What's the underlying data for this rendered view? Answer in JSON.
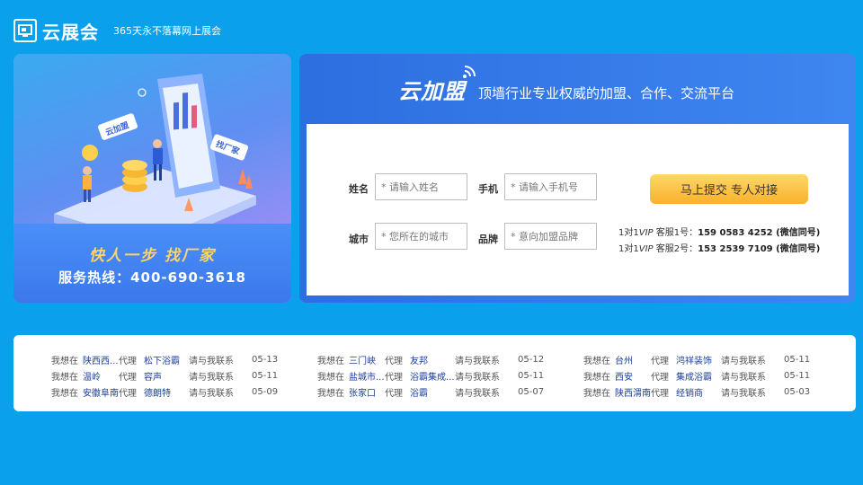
{
  "header": {
    "logo_text": "云展会",
    "tagline": "365天永不落幕网上展会"
  },
  "banner": {
    "slogan": "快人一步 找厂家",
    "hotline": "服务热线：400-690-3618",
    "illustration_tag_left": "云加盟",
    "illustration_tag_right": "找厂家"
  },
  "panel": {
    "brand": "云加盟",
    "subtitle": "顶墙行业专业权威的加盟、合作、交流平台",
    "fields": {
      "name_label": "姓名",
      "name_placeholder": "* 请输入姓名",
      "phone_label": "手机",
      "phone_placeholder": "* 请输入手机号",
      "city_label": "城市",
      "city_placeholder": "* 您所在的城市",
      "brand_label": "品牌",
      "brand_placeholder": "* 意向加盟品牌"
    },
    "submit_label": "马上提交 专人对接",
    "vip": [
      {
        "prefix": "1对1",
        "vip": "VIP",
        "service": "客服1号：",
        "phone": "159 0583 4252",
        "note": " (微信同号)"
      },
      {
        "prefix": "1对1",
        "vip": "VIP",
        "service": "客服2号：",
        "phone": "153 2539 7109",
        "note": " (微信同号)"
      }
    ]
  },
  "list": {
    "columns": [
      [
        {
          "pre": "我想在",
          "city": "陕西西...",
          "agent": "代理",
          "brand": "松下浴霸",
          "contact": "请与我联系",
          "date": "05-13"
        },
        {
          "pre": "我想在",
          "city": "温岭",
          "agent": "代理",
          "brand": "容声",
          "contact": "请与我联系",
          "date": "05-11"
        },
        {
          "pre": "我想在",
          "city": "安徽阜南",
          "agent": "代理",
          "brand": "德朗特",
          "contact": "请与我联系",
          "date": "05-09"
        }
      ],
      [
        {
          "pre": "我想在",
          "city": "三门峡",
          "agent": "代理",
          "brand": "友邦",
          "contact": "请与我联系",
          "date": "05-12"
        },
        {
          "pre": "我想在",
          "city": "盐城市...",
          "agent": "代理",
          "brand": "浴霸集成...",
          "contact": "请与我联系",
          "date": "05-11"
        },
        {
          "pre": "我想在",
          "city": "张家口",
          "agent": "代理",
          "brand": "浴霸",
          "contact": "请与我联系",
          "date": "05-07"
        }
      ],
      [
        {
          "pre": "我想在",
          "city": "台州",
          "agent": "代理",
          "brand": "鸿祥装饰",
          "contact": "请与我联系",
          "date": "05-11"
        },
        {
          "pre": "我想在",
          "city": "西安",
          "agent": "代理",
          "brand": "集成浴霸",
          "contact": "请与我联系",
          "date": "05-11"
        },
        {
          "pre": "我想在",
          "city": "陕西渭南",
          "agent": "代理",
          "brand": "经销商",
          "contact": "请与我联系",
          "date": "05-03"
        }
      ]
    ]
  }
}
